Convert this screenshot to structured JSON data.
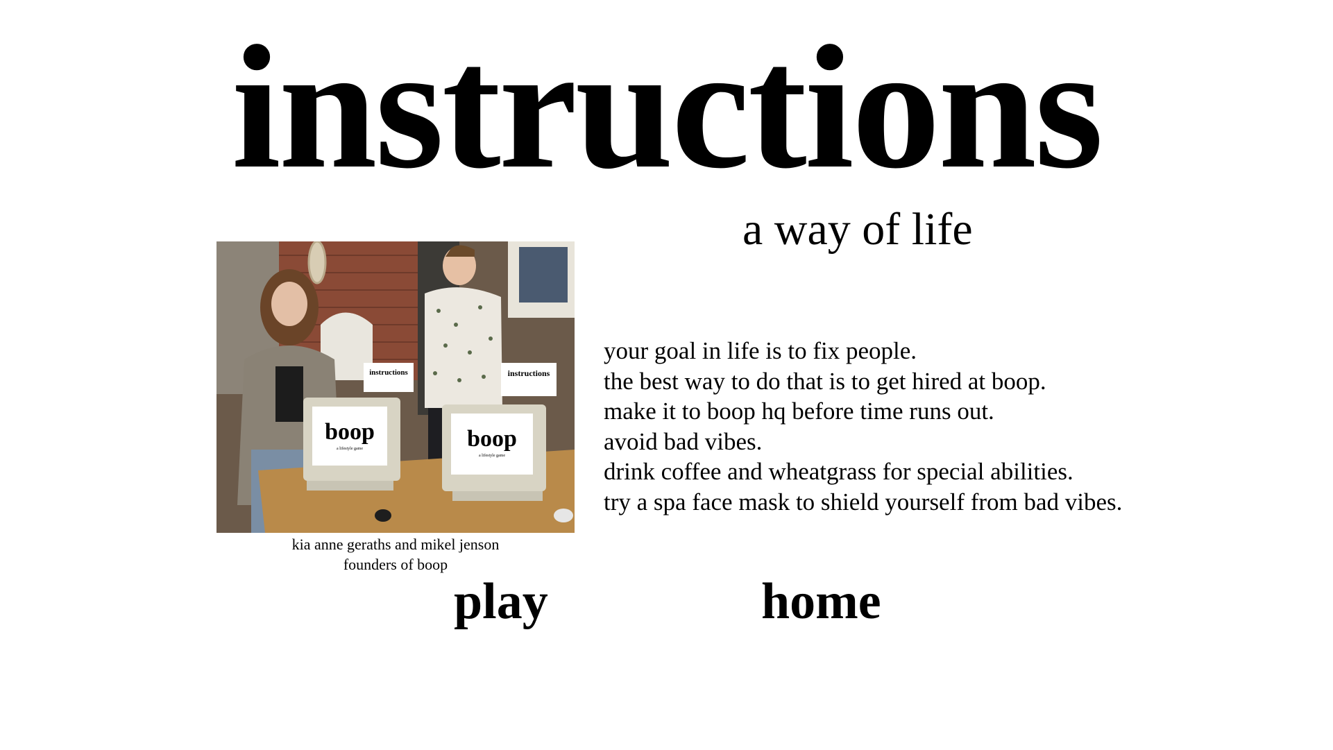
{
  "page": {
    "title": "instructions",
    "subtitle": "a way of life"
  },
  "photo": {
    "caption_line1": "kia anne geraths and mikel jenson",
    "caption_line2": "founders of boop",
    "screen_logo": "boop",
    "screen_tagline": "a lifestyle game",
    "sign_text": "instructions"
  },
  "instructions": [
    "your goal in life is to fix people.",
    "the best way to do that is to get hired at boop.",
    "make it to boop hq before time runs out.",
    "avoid bad vibes.",
    "drink coffee and wheatgrass for special abilities.",
    "try a spa face mask to shield yourself from bad vibes."
  ],
  "nav": {
    "play_label": "play",
    "home_label": "home"
  },
  "colors": {
    "background": "#ffffff",
    "text": "#000000"
  }
}
